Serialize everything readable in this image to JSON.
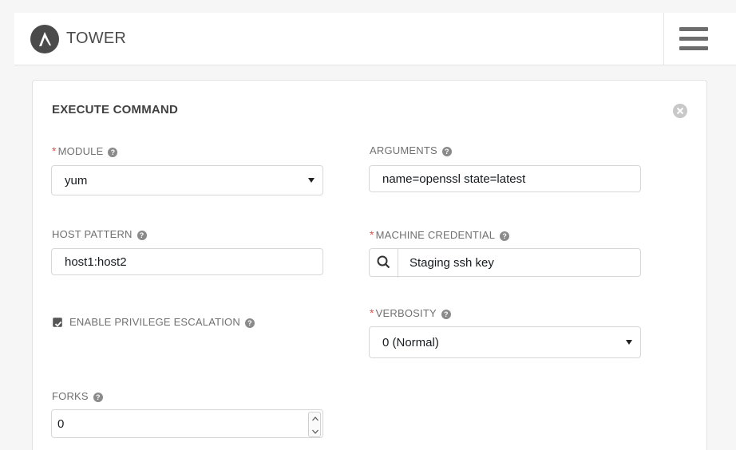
{
  "header": {
    "brand": "TOWER",
    "logo_letter": "A",
    "menu_icon": "hamburger-icon"
  },
  "panel": {
    "title": "EXECUTE COMMAND",
    "close_icon": "close-circle-icon"
  },
  "fields": {
    "module": {
      "label": "MODULE",
      "required": "*",
      "value": "yum",
      "help": "?"
    },
    "arguments": {
      "label": "ARGUMENTS",
      "value": "name=openssl state=latest",
      "help": "?"
    },
    "host_pattern": {
      "label": "HOST PATTERN",
      "value": "host1:host2",
      "help": "?"
    },
    "machine_credential": {
      "label": "MACHINE CREDENTIAL",
      "required": "*",
      "value": "Staging ssh key",
      "help": "?",
      "icon": "search-icon"
    },
    "privilege_escalation": {
      "label": "ENABLE PRIVILEGE ESCALATION",
      "checked": true,
      "help": "?"
    },
    "verbosity": {
      "label": "VERBOSITY",
      "required": "*",
      "value": "0 (Normal)",
      "help": "?"
    },
    "forks": {
      "label": "FORKS",
      "value": "0",
      "help": "?"
    }
  },
  "colors": {
    "required": "#d9534f",
    "logo": "#4a4a4a",
    "label": "#707070",
    "border": "#d7d7d7"
  }
}
